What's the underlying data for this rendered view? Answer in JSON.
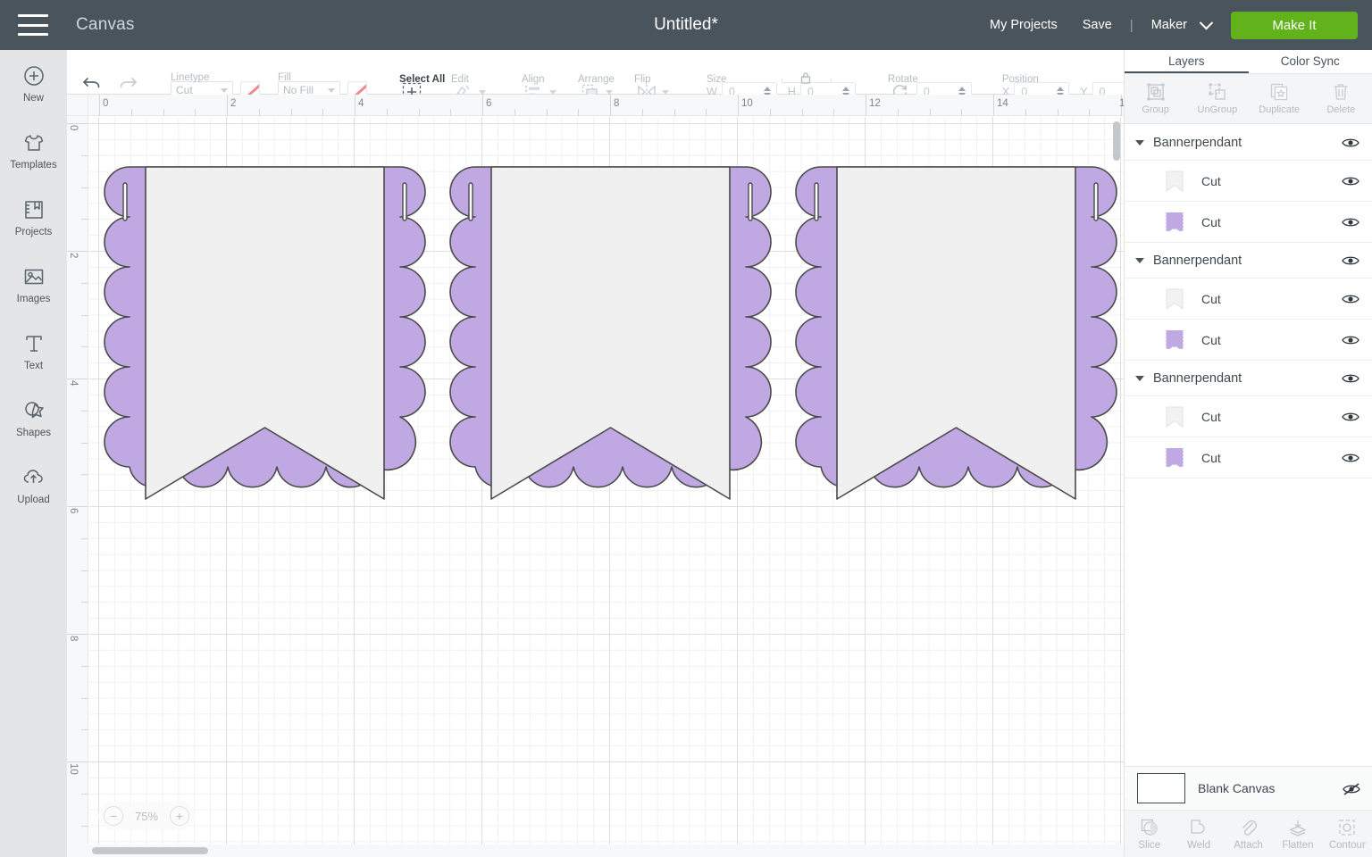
{
  "topbar": {
    "menu_icon": "hamburger-icon",
    "app_title": "Canvas",
    "document_title": "Untitled*",
    "my_projects": "My Projects",
    "save": "Save",
    "separator": "|",
    "machine": "Maker",
    "make_it": "Make It",
    "accent_green": "#62b21c",
    "bar_color": "#49545c"
  },
  "sidebar": {
    "items": [
      {
        "label": "New",
        "icon": "plus-circle-icon"
      },
      {
        "label": "Templates",
        "icon": "tshirt-icon"
      },
      {
        "label": "Projects",
        "icon": "book-bookmark-icon"
      },
      {
        "label": "Images",
        "icon": "image-icon"
      },
      {
        "label": "Text",
        "icon": "text-t-icon"
      },
      {
        "label": "Shapes",
        "icon": "star-shape-icon"
      },
      {
        "label": "Upload",
        "icon": "cloud-upload-icon"
      }
    ]
  },
  "toolbar": {
    "undo": "undo-icon",
    "redo": "redo-icon",
    "linetype": {
      "label": "Linetype",
      "value": "Cut",
      "swatch": "line-color-swatch"
    },
    "fill": {
      "label": "Fill",
      "value": "No Fill",
      "swatch": "fill-color-swatch"
    },
    "select_all": {
      "label": "Select All",
      "icon": "select-all-icon"
    },
    "edit": {
      "label": "Edit",
      "icon": "edit-icon"
    },
    "align": {
      "label": "Align",
      "icon": "align-icon"
    },
    "arrange": {
      "label": "Arrange",
      "icon": "arrange-icon"
    },
    "flip": {
      "label": "Flip",
      "icon": "flip-icon"
    },
    "size": {
      "label": "Size",
      "w_label": "W",
      "w_value": "0",
      "h_label": "H",
      "h_value": "0",
      "lock_icon": "lock-icon"
    },
    "rotate": {
      "label": "Rotate",
      "value": "0",
      "icon": "rotate-icon"
    },
    "position": {
      "label": "Position",
      "x_label": "X",
      "x_value": "0",
      "y_label": "Y",
      "y_value": "0"
    }
  },
  "canvas": {
    "zoom": "75%",
    "zoom_out": "−",
    "zoom_in": "+",
    "ruler_h_labels": [
      "0",
      "2",
      "4",
      "6",
      "8",
      "10",
      "12",
      "14",
      "1"
    ],
    "ruler_v_labels": [
      "0",
      "2",
      "4",
      "6",
      "8",
      "10"
    ],
    "shape_fill_purple": "#c0a8e2",
    "shape_fill_white": "#f0f0f0",
    "shape_stroke": "#4a4a4a",
    "grid_major": "#dedede",
    "grid_minor": "#f0f0f0",
    "banner_count": 3
  },
  "right_panel": {
    "tabs": [
      {
        "label": "Layers",
        "active": true
      },
      {
        "label": "Color Sync",
        "active": false
      }
    ],
    "actions": [
      {
        "label": "Group",
        "icon": "group-icon"
      },
      {
        "label": "UnGroup",
        "icon": "ungroup-icon"
      },
      {
        "label": "Duplicate",
        "icon": "duplicate-icon"
      },
      {
        "label": "Delete",
        "icon": "trash-icon"
      }
    ],
    "groups": [
      {
        "name": "Bannerpendant",
        "expanded": true,
        "layers": [
          {
            "name": "Cut",
            "thumb": "banner-white-thumb"
          },
          {
            "name": "Cut",
            "thumb": "banner-purple-thumb"
          }
        ]
      },
      {
        "name": "Bannerpendant",
        "expanded": true,
        "layers": [
          {
            "name": "Cut",
            "thumb": "banner-white-thumb"
          },
          {
            "name": "Cut",
            "thumb": "banner-purple-thumb"
          }
        ]
      },
      {
        "name": "Bannerpendant",
        "expanded": true,
        "layers": [
          {
            "name": "Cut",
            "thumb": "banner-white-thumb"
          },
          {
            "name": "Cut",
            "thumb": "banner-purple-thumb"
          }
        ]
      }
    ],
    "blank_canvas": {
      "label": "Blank Canvas",
      "hidden": true
    },
    "bottom_tools": [
      {
        "label": "Slice",
        "icon": "slice-icon"
      },
      {
        "label": "Weld",
        "icon": "weld-icon"
      },
      {
        "label": "Attach",
        "icon": "paperclip-icon"
      },
      {
        "label": "Flatten",
        "icon": "flatten-icon"
      },
      {
        "label": "Contour",
        "icon": "contour-icon"
      }
    ]
  }
}
